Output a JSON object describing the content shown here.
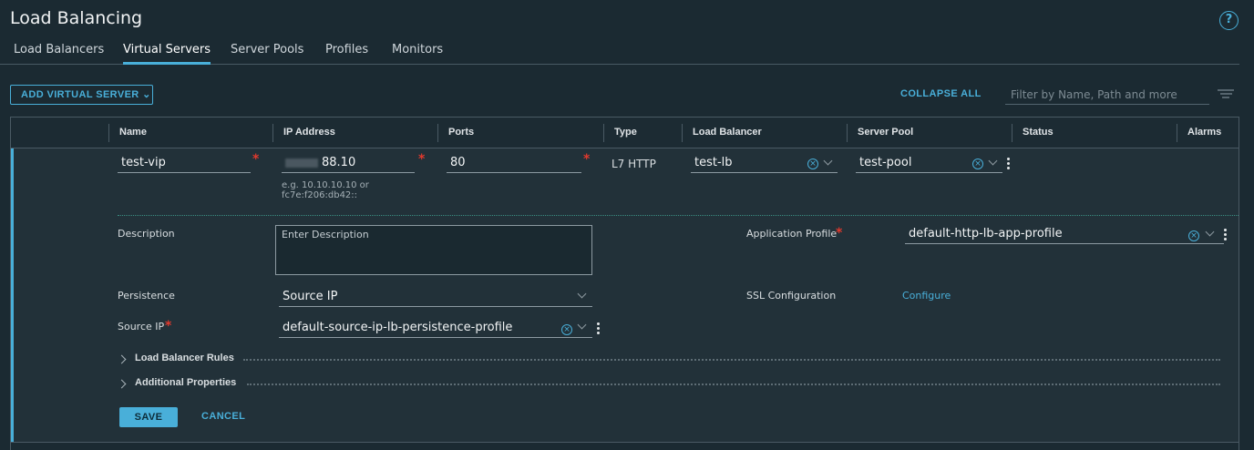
{
  "page": {
    "title": "Load Balancing",
    "help_icon": "?"
  },
  "tabs": [
    {
      "label": "Load Balancers",
      "active": false
    },
    {
      "label": "Virtual Servers",
      "active": true
    },
    {
      "label": "Server Pools",
      "active": false
    },
    {
      "label": "Profiles",
      "active": false
    },
    {
      "label": "Monitors",
      "active": false
    }
  ],
  "toolbar": {
    "add_label": "ADD VIRTUAL SERVER ⌄",
    "collapse_label": "COLLAPSE ALL",
    "filter_placeholder": "Filter by Name, Path and more"
  },
  "columns": [
    "Name",
    "IP Address",
    "Ports",
    "Type",
    "Load Balancer",
    "Server Pool",
    "Status",
    "Alarms"
  ],
  "row": {
    "name": "test-vip",
    "ip_address": "88.10",
    "ip_hint": "e.g. 10.10.10.10 or fc7e:f206:db42::",
    "ports": "80",
    "type": "L7 HTTP",
    "load_balancer": "test-lb",
    "server_pool": "test-pool"
  },
  "details": {
    "description_label": "Description",
    "description_placeholder": "Enter Description",
    "app_profile_label": "Application Profile",
    "app_profile_value": "default-http-lb-app-profile",
    "persistence_label": "Persistence",
    "persistence_value": "Source IP",
    "ssl_label": "SSL Configuration",
    "ssl_link": "Configure",
    "source_ip_label": "Source IP",
    "source_ip_value": "default-source-ip-lb-persistence-profile",
    "required_mark": "*",
    "clear_mark": "×",
    "sections": [
      "Load Balancer Rules",
      "Additional Properties"
    ],
    "save_label": "SAVE",
    "cancel_label": "CANCEL"
  },
  "colors": {
    "accent": "#49afd9",
    "required": "#e0392d",
    "background": "#1b2a32"
  },
  "icons": [
    "help-icon",
    "filter-icon",
    "clear-icon",
    "chevron-down-icon",
    "kebab-icon",
    "caret-right-icon"
  ]
}
